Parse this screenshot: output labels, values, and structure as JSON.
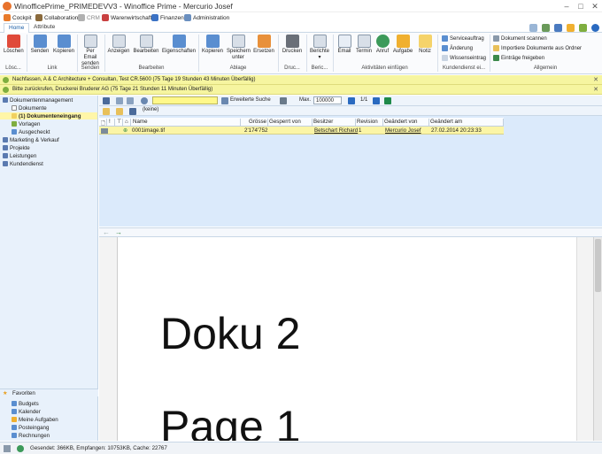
{
  "window": {
    "title": "WinofficePrime_PRIMEDEVV3 - Winoffice Prime - Mercurio Josef"
  },
  "menu": {
    "items": [
      "Cockpit",
      "Collaboration",
      "CRM",
      "Warenwirtschaft",
      "Finanzen",
      "Administration"
    ]
  },
  "tabs": [
    "Home",
    "Attribute"
  ],
  "ribbon": {
    "groups": {
      "loeschen": "Lösc...",
      "link": "Link",
      "senden": "Senden",
      "bearbeiten": "Bearbeiten",
      "ablage": "Ablage",
      "drucken": "Druc...",
      "berichte": "Beric...",
      "aktivitaeten": "Aktivitäten einfügen",
      "kundendienst": "Kundendienst ei...",
      "allgemein": "Allgemein"
    },
    "buttons": {
      "loeschen": "Löschen",
      "senden_link": "Senden",
      "kopieren_link": "Kopieren",
      "per_email_senden_1": "Per Email",
      "per_email_senden_2": "senden",
      "anzeigen": "Anzeigen",
      "bearbeiten": "Bearbeiten",
      "eigenschaften": "Eigenschaften",
      "kopieren": "Kopieren",
      "speichern_unter_1": "Speichern",
      "speichern_unter_2": "unter",
      "ersetzen": "Ersetzen",
      "drucken": "Drucken",
      "berichte": "Berichte",
      "email": "Email",
      "termin": "Termin",
      "anruf": "Anruf",
      "aufgabe": "Aufgabe",
      "notiz": "Notiz",
      "serviceauftrag": "Serviceauftrag",
      "aenderung": "Änderung",
      "wissenseintrag": "Wissenseintrag",
      "dokument_scannen": "Dokument scannen",
      "importiere": "Importiere Dokumente aus Ordner",
      "eintraege_freigeben": "Einträge freigeben"
    }
  },
  "notices": [
    "Nachfassen, A & C Architecture + Consultan, Test CR.5600 (75 Tage 19 Stunden 43 Minuten Überfällig)",
    "Bitte zurückrufen, Druckerei Bruderer AG (75 Tage 21 Stunden 11 Minuten Überfällig)"
  ],
  "sidebar": {
    "section": "Dokumentenmanagement",
    "items": [
      "Dokumente",
      "(1) Dokumenteneingang",
      "Vorlagen",
      "Ausgecheckt"
    ],
    "other_sections": [
      "Marketing & Verkauf",
      "Projekte",
      "Leistungen",
      "Kundendienst"
    ],
    "favorites_title": "Favoriten",
    "favorites": [
      "Budgets",
      "Kalender",
      "Meine Aufgaben",
      "Posteingang",
      "Rechnungen"
    ]
  },
  "toolbar": {
    "search_mode": "Erweiterte Suche",
    "max_label": "Max.",
    "max_value": "100000",
    "page": "1/1",
    "filter": "(keine)"
  },
  "grid": {
    "columns": [
      "Name",
      "Grösse",
      "Gesperrt von",
      "Besitzer",
      "Revision",
      "Geändert von",
      "Geändert am"
    ],
    "rows": [
      {
        "name": "0001image.tif",
        "groesse": "2'174'752",
        "gesperrt_von": "",
        "besitzer": "Betschart Richard",
        "revision": "1",
        "geaendert_von": "Mercurio Josef",
        "geaendert_am": "27.02.2014 20:23:33"
      }
    ]
  },
  "preview": {
    "line1": "Doku 2",
    "line2": "Page 1"
  },
  "status": {
    "text": "Gesendet: 366KB, Empfangen: 10753KB, Cache: 22767"
  },
  "colors": {
    "accent": "#1a5ea8",
    "notice": "#f6f5a0",
    "selection": "#fff6a8",
    "sidebar": "#e8f1fb"
  }
}
